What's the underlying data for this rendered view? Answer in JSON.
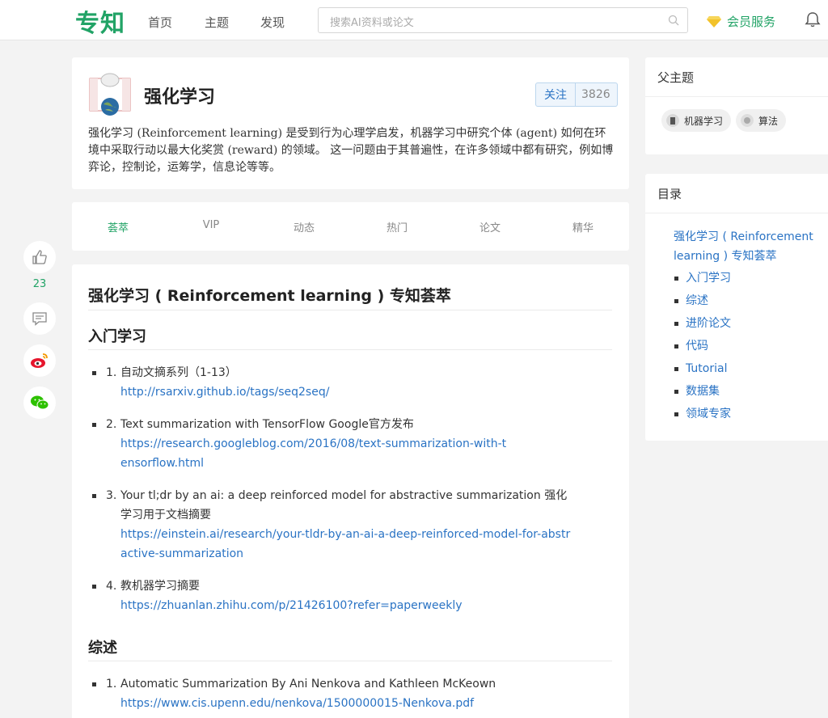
{
  "header": {
    "logo": "专知",
    "nav": [
      "首页",
      "主题",
      "发现"
    ],
    "search_placeholder": "搜索AI资料或论文",
    "vip_label": "会员服务"
  },
  "actions": {
    "like_count": "23"
  },
  "topic": {
    "title": "强化学习",
    "follow_label": "关注",
    "follow_count": "3826",
    "description": "强化学习 (Reinforcement learning) 是受到行为心理学启发，机器学习中研究个体 (agent) 如何在环境中采取行动以最大化奖赏 (reward) 的领域。 这一问题由于其普遍性，在许多领域中都有研究，例如博弈论，控制论，运筹学，信息论等等。"
  },
  "tabs": [
    "荟萃",
    "VIP",
    "动态",
    "热门",
    "论文",
    "精华"
  ],
  "content": {
    "title": "强化学习 ( Reinforcement learning ) 专知荟萃",
    "sections": [
      {
        "heading": "入门学习",
        "items": [
          {
            "num": "1.",
            "text": "自动文摘系列（1-13）",
            "link": "http://rsarxiv.github.io/tags/seq2seq/"
          },
          {
            "num": "2.",
            "text": "Text summarization with TensorFlow Google官方发布",
            "link": "https://research.googleblog.com/2016/08/text-summarization-with-tensorflow.html"
          },
          {
            "num": "3.",
            "text": "Your tl;dr by an ai: a deep reinforced model for abstractive summarization 强化学习用于文档摘要",
            "link": "https://einstein.ai/research/your-tldr-by-an-ai-a-deep-reinforced-model-for-abstractive-summarization"
          },
          {
            "num": "4.",
            "text": "教机器学习摘要",
            "link": "https://zhuanlan.zhihu.com/p/21426100?refer=paperweekly"
          }
        ]
      },
      {
        "heading": "综述",
        "items": [
          {
            "num": "1.",
            "text": "Automatic Summarization By Ani Nenkova and Kathleen McKeown",
            "link": "https://www.cis.upenn.edu/nenkova/1500000015-Nenkova.pdf"
          }
        ]
      }
    ]
  },
  "sidebar": {
    "parent_heading": "父主题",
    "parents": [
      "机器学习",
      "算法"
    ],
    "toc_heading": "目录",
    "toc_main": "强化学习 ( Reinforcement learning ) 专知荟萃",
    "toc_items": [
      "入门学习",
      "综述",
      "进阶论文",
      "代码",
      "Tutorial",
      "数据集",
      "领域专家"
    ]
  },
  "colors": {
    "brand": "#21a366",
    "link": "#2a73c4"
  }
}
